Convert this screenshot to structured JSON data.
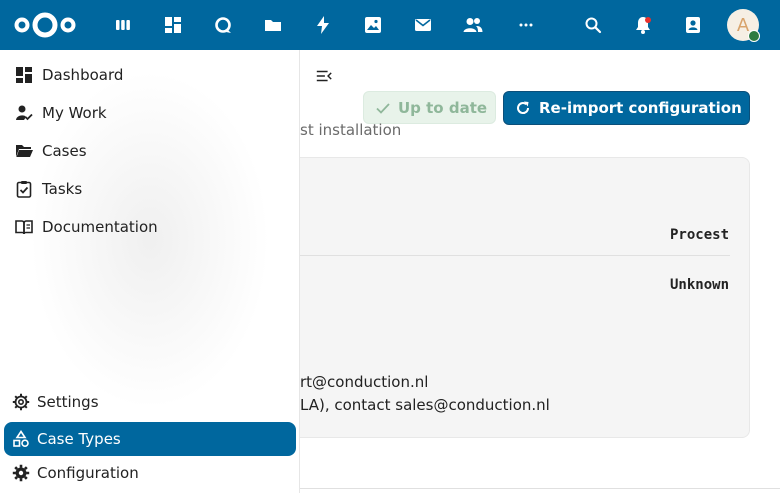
{
  "header": {
    "brand_color": "#00679e",
    "logo_icon": "nextcloud-logo-icon",
    "apps": [
      {
        "name": "deck-icon"
      },
      {
        "name": "dashboard-icon"
      },
      {
        "name": "talk-icon"
      },
      {
        "name": "files-icon"
      },
      {
        "name": "activity-icon"
      },
      {
        "name": "photos-icon"
      },
      {
        "name": "mail-icon"
      },
      {
        "name": "contacts-icon"
      },
      {
        "name": "more-apps-icon"
      }
    ],
    "right_icons": [
      {
        "name": "search-icon"
      },
      {
        "name": "notifications-icon"
      },
      {
        "name": "contacts-menu-icon"
      }
    ],
    "avatar_initial": "A",
    "avatar_status": "online"
  },
  "sidebar": {
    "items": [
      {
        "label": "Dashboard",
        "icon": "dashboard-icon"
      },
      {
        "label": "My Work",
        "icon": "account-check-icon"
      },
      {
        "label": "Cases",
        "icon": "folder-open-icon"
      },
      {
        "label": "Tasks",
        "icon": "clipboard-check-icon"
      },
      {
        "label": "Documentation",
        "icon": "book-open-icon"
      }
    ],
    "bottom_items": [
      {
        "label": "Settings",
        "icon": "settings-icon"
      },
      {
        "label": "Case Types",
        "icon": "shapes-icon",
        "active": true
      },
      {
        "label": "Configuration",
        "icon": "cog-icon"
      }
    ]
  },
  "main": {
    "uptodate_label": "Up to date",
    "reimport_label": "Re-import configuration",
    "subtitle": "st installation",
    "table": {
      "header": "Procest",
      "value": "Unknown"
    },
    "support_lines": [
      "rt@conduction.nl",
      "LA), contact sales@conduction.nl"
    ]
  }
}
